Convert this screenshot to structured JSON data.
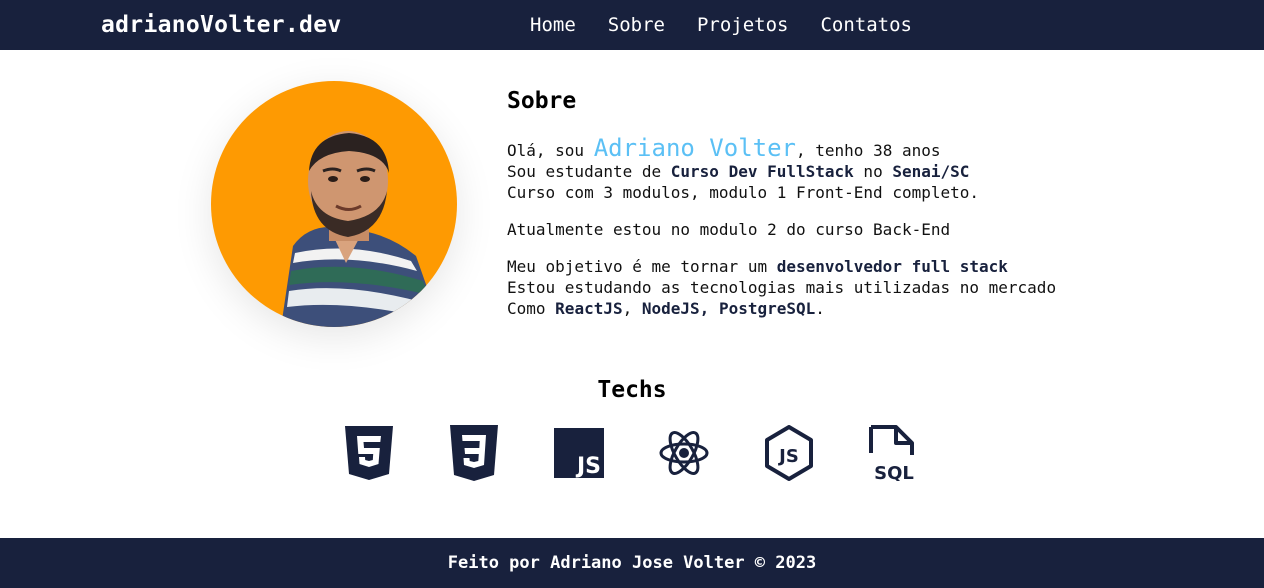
{
  "header": {
    "logo": "adrianoVolter.dev",
    "nav": [
      "Home",
      "Sobre",
      "Projetos",
      "Contatos"
    ]
  },
  "about": {
    "title": "Sobre",
    "greeting_prefix": "Olá, sou ",
    "name": "Adriano Volter",
    "greeting_suffix": ", tenho 38 anos",
    "line2_prefix": "Sou estudante de ",
    "course": "Curso Dev FullStack",
    "line2_mid": " no ",
    "school": "Senai/SC",
    "line3": "Curso com 3 modulos, modulo 1 Front-End completo.",
    "para2": "Atualmente estou no modulo 2 do curso Back-End",
    "goal_prefix": "Meu objetivo é me tornar um ",
    "goal": "desenvolvedor full stack",
    "study_line": "Estou estudando as tecnologias mais utilizadas no mercado",
    "como": "Como ",
    "techs_highlight_1": "ReactJS",
    "comma": ", ",
    "techs_highlight_2": "NodeJS, PostgreSQL",
    "period": "."
  },
  "techs": {
    "title": "Techs",
    "icons": [
      "html5-icon",
      "css3-icon",
      "javascript-icon",
      "react-icon",
      "nodejs-icon",
      "sql-file-icon"
    ]
  },
  "footer": {
    "text": "Feito por Adriano Jose Volter © 2023"
  },
  "colors": {
    "navy": "#18213d",
    "accent_orange": "#fe9a02",
    "name_blue": "#5bc0f5"
  }
}
